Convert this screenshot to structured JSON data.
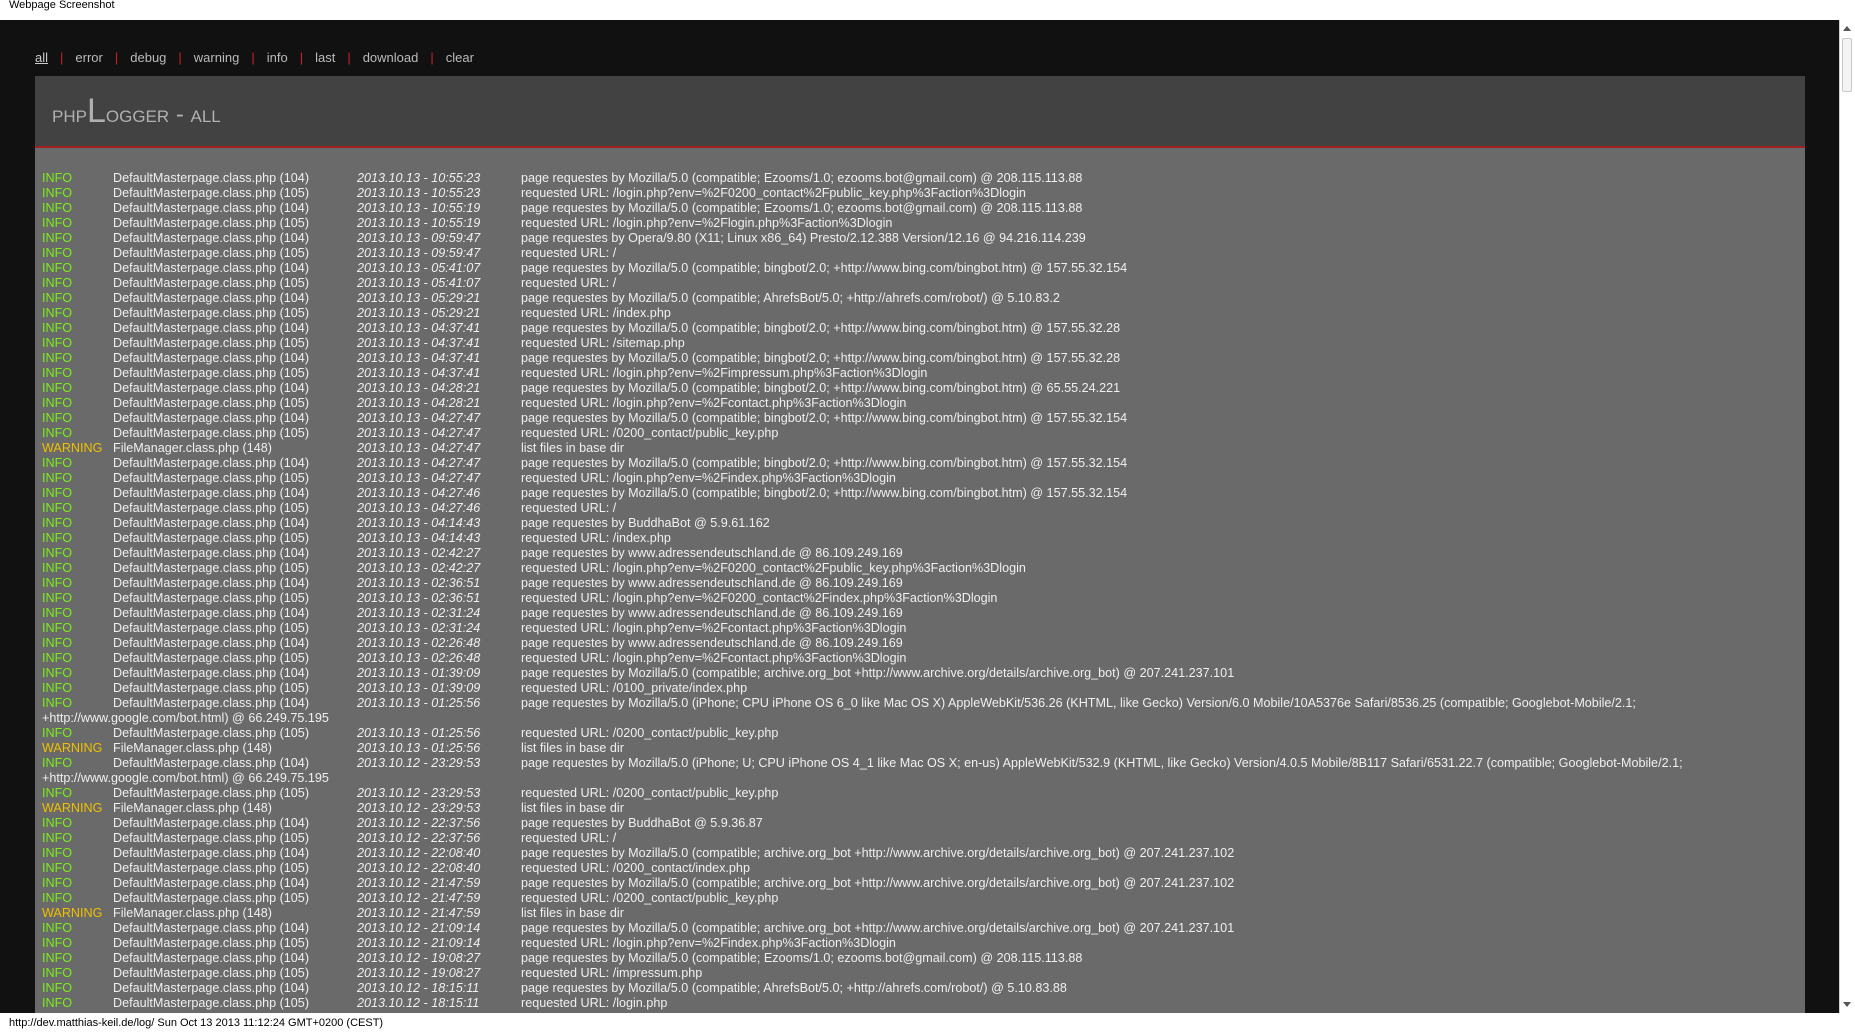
{
  "window_title": "Webpage Screenshot",
  "status_bar": "http://dev.matthias-keil.de/log/ Sun Oct 13 2013 11:12:24 GMT+0200 (CEST)",
  "nav": [
    {
      "label": "all",
      "active": true
    },
    {
      "label": "error"
    },
    {
      "label": "debug"
    },
    {
      "label": "warning"
    },
    {
      "label": "info"
    },
    {
      "label": "last"
    },
    {
      "label": "download"
    },
    {
      "label": "clear"
    }
  ],
  "title": {
    "prefix": "php",
    "big": "L",
    "rest": "ogger - all"
  },
  "colors": {
    "info": "#7aee1a",
    "warning": "#f0c000",
    "separator": "#cc2222",
    "panel": "#6a6a6a",
    "header": "#424242"
  },
  "log": [
    {
      "level": "INFO",
      "source": "DefaultMasterpage.class.php (104)",
      "time": "2013.10.13 - 10:55:23",
      "message": "page requestes by Mozilla/5.0 (compatible; Ezooms/1.0; ezooms.bot@gmail.com) @ 208.115.113.88"
    },
    {
      "level": "INFO",
      "source": "DefaultMasterpage.class.php (105)",
      "time": "2013.10.13 - 10:55:23",
      "message": "requested URL: /login.php?env=%2F0200_contact%2Fpublic_key.php%3Faction%3Dlogin"
    },
    {
      "level": "INFO",
      "source": "DefaultMasterpage.class.php (104)",
      "time": "2013.10.13 - 10:55:19",
      "message": "page requestes by Mozilla/5.0 (compatible; Ezooms/1.0; ezooms.bot@gmail.com) @ 208.115.113.88"
    },
    {
      "level": "INFO",
      "source": "DefaultMasterpage.class.php (105)",
      "time": "2013.10.13 - 10:55:19",
      "message": "requested URL: /login.php?env=%2Flogin.php%3Faction%3Dlogin"
    },
    {
      "level": "INFO",
      "source": "DefaultMasterpage.class.php (104)",
      "time": "2013.10.13 - 09:59:47",
      "message": "page requestes by Opera/9.80 (X11; Linux x86_64) Presto/2.12.388 Version/12.16 @ 94.216.114.239"
    },
    {
      "level": "INFO",
      "source": "DefaultMasterpage.class.php (105)",
      "time": "2013.10.13 - 09:59:47",
      "message": "requested URL: /"
    },
    {
      "level": "INFO",
      "source": "DefaultMasterpage.class.php (104)",
      "time": "2013.10.13 - 05:41:07",
      "message": "page requestes by Mozilla/5.0 (compatible; bingbot/2.0; +http://www.bing.com/bingbot.htm) @ 157.55.32.154"
    },
    {
      "level": "INFO",
      "source": "DefaultMasterpage.class.php (105)",
      "time": "2013.10.13 - 05:41:07",
      "message": "requested URL: /"
    },
    {
      "level": "INFO",
      "source": "DefaultMasterpage.class.php (104)",
      "time": "2013.10.13 - 05:29:21",
      "message": "page requestes by Mozilla/5.0 (compatible; AhrefsBot/5.0; +http://ahrefs.com/robot/) @ 5.10.83.2"
    },
    {
      "level": "INFO",
      "source": "DefaultMasterpage.class.php (105)",
      "time": "2013.10.13 - 05:29:21",
      "message": "requested URL: /index.php"
    },
    {
      "level": "INFO",
      "source": "DefaultMasterpage.class.php (104)",
      "time": "2013.10.13 - 04:37:41",
      "message": "page requestes by Mozilla/5.0 (compatible; bingbot/2.0; +http://www.bing.com/bingbot.htm) @ 157.55.32.28"
    },
    {
      "level": "INFO",
      "source": "DefaultMasterpage.class.php (105)",
      "time": "2013.10.13 - 04:37:41",
      "message": "requested URL: /sitemap.php"
    },
    {
      "level": "INFO",
      "source": "DefaultMasterpage.class.php (104)",
      "time": "2013.10.13 - 04:37:41",
      "message": "page requestes by Mozilla/5.0 (compatible; bingbot/2.0; +http://www.bing.com/bingbot.htm) @ 157.55.32.28"
    },
    {
      "level": "INFO",
      "source": "DefaultMasterpage.class.php (105)",
      "time": "2013.10.13 - 04:37:41",
      "message": "requested URL: /login.php?env=%2Fimpressum.php%3Faction%3Dlogin"
    },
    {
      "level": "INFO",
      "source": "DefaultMasterpage.class.php (104)",
      "time": "2013.10.13 - 04:28:21",
      "message": "page requestes by Mozilla/5.0 (compatible; bingbot/2.0; +http://www.bing.com/bingbot.htm) @ 65.55.24.221"
    },
    {
      "level": "INFO",
      "source": "DefaultMasterpage.class.php (105)",
      "time": "2013.10.13 - 04:28:21",
      "message": "requested URL: /login.php?env=%2Fcontact.php%3Faction%3Dlogin"
    },
    {
      "level": "INFO",
      "source": "DefaultMasterpage.class.php (104)",
      "time": "2013.10.13 - 04:27:47",
      "message": "page requestes by Mozilla/5.0 (compatible; bingbot/2.0; +http://www.bing.com/bingbot.htm) @ 157.55.32.154"
    },
    {
      "level": "INFO",
      "source": "DefaultMasterpage.class.php (105)",
      "time": "2013.10.13 - 04:27:47",
      "message": "requested URL: /0200_contact/public_key.php"
    },
    {
      "level": "WARNING",
      "source": "FileManager.class.php (148)",
      "time": "2013.10.13 - 04:27:47",
      "message": "list files in base dir"
    },
    {
      "level": "INFO",
      "source": "DefaultMasterpage.class.php (104)",
      "time": "2013.10.13 - 04:27:47",
      "message": "page requestes by Mozilla/5.0 (compatible; bingbot/2.0; +http://www.bing.com/bingbot.htm) @ 157.55.32.154"
    },
    {
      "level": "INFO",
      "source": "DefaultMasterpage.class.php (105)",
      "time": "2013.10.13 - 04:27:47",
      "message": "requested URL: /login.php?env=%2Findex.php%3Faction%3Dlogin"
    },
    {
      "level": "INFO",
      "source": "DefaultMasterpage.class.php (104)",
      "time": "2013.10.13 - 04:27:46",
      "message": "page requestes by Mozilla/5.0 (compatible; bingbot/2.0; +http://www.bing.com/bingbot.htm) @ 157.55.32.154"
    },
    {
      "level": "INFO",
      "source": "DefaultMasterpage.class.php (105)",
      "time": "2013.10.13 - 04:27:46",
      "message": "requested URL: /"
    },
    {
      "level": "INFO",
      "source": "DefaultMasterpage.class.php (104)",
      "time": "2013.10.13 - 04:14:43",
      "message": "page requestes by BuddhaBot @ 5.9.61.162"
    },
    {
      "level": "INFO",
      "source": "DefaultMasterpage.class.php (105)",
      "time": "2013.10.13 - 04:14:43",
      "message": "requested URL: /index.php"
    },
    {
      "level": "INFO",
      "source": "DefaultMasterpage.class.php (104)",
      "time": "2013.10.13 - 02:42:27",
      "message": "page requestes by www.adressendeutschland.de @ 86.109.249.169"
    },
    {
      "level": "INFO",
      "source": "DefaultMasterpage.class.php (105)",
      "time": "2013.10.13 - 02:42:27",
      "message": "requested URL: /login.php?env=%2F0200_contact%2Fpublic_key.php%3Faction%3Dlogin"
    },
    {
      "level": "INFO",
      "source": "DefaultMasterpage.class.php (104)",
      "time": "2013.10.13 - 02:36:51",
      "message": "page requestes by www.adressendeutschland.de @ 86.109.249.169"
    },
    {
      "level": "INFO",
      "source": "DefaultMasterpage.class.php (105)",
      "time": "2013.10.13 - 02:36:51",
      "message": "requested URL: /login.php?env=%2F0200_contact%2Findex.php%3Faction%3Dlogin"
    },
    {
      "level": "INFO",
      "source": "DefaultMasterpage.class.php (104)",
      "time": "2013.10.13 - 02:31:24",
      "message": "page requestes by www.adressendeutschland.de @ 86.109.249.169"
    },
    {
      "level": "INFO",
      "source": "DefaultMasterpage.class.php (105)",
      "time": "2013.10.13 - 02:31:24",
      "message": "requested URL: /login.php?env=%2Fcontact.php%3Faction%3Dlogin"
    },
    {
      "level": "INFO",
      "source": "DefaultMasterpage.class.php (104)",
      "time": "2013.10.13 - 02:26:48",
      "message": "page requestes by www.adressendeutschland.de @ 86.109.249.169"
    },
    {
      "level": "INFO",
      "source": "DefaultMasterpage.class.php (105)",
      "time": "2013.10.13 - 02:26:48",
      "message": "requested URL: /login.php?env=%2Fcontact.php%3Faction%3Dlogin"
    },
    {
      "level": "INFO",
      "source": "DefaultMasterpage.class.php (104)",
      "time": "2013.10.13 - 01:39:09",
      "message": "page requestes by Mozilla/5.0 (compatible; archive.org_bot +http://www.archive.org/details/archive.org_bot) @ 207.241.237.101"
    },
    {
      "level": "INFO",
      "source": "DefaultMasterpage.class.php (105)",
      "time": "2013.10.13 - 01:39:09",
      "message": "requested URL: /0100_private/index.php"
    },
    {
      "level": "INFO",
      "source": "DefaultMasterpage.class.php (104)",
      "time": "2013.10.13 - 01:25:56",
      "message": "page requestes by Mozilla/5.0 (iPhone; CPU iPhone OS 6_0 like Mac OS X) AppleWebKit/536.26 (KHTML, like Gecko) Version/6.0 Mobile/10A5376e Safari/8536.25 (compatible; Googlebot-Mobile/2.1;",
      "continuation": "+http://www.google.com/bot.html) @ 66.249.75.195"
    },
    {
      "level": "INFO",
      "source": "DefaultMasterpage.class.php (105)",
      "time": "2013.10.13 - 01:25:56",
      "message": "requested URL: /0200_contact/public_key.php"
    },
    {
      "level": "WARNING",
      "source": "FileManager.class.php (148)",
      "time": "2013.10.13 - 01:25:56",
      "message": "list files in base dir"
    },
    {
      "level": "INFO",
      "source": "DefaultMasterpage.class.php (104)",
      "time": "2013.10.12 - 23:29:53",
      "message": "page requestes by Mozilla/5.0 (iPhone; U; CPU iPhone OS 4_1 like Mac OS X; en-us) AppleWebKit/532.9 (KHTML, like Gecko) Version/4.0.5 Mobile/8B117 Safari/6531.22.7 (compatible; Googlebot-Mobile/2.1;",
      "continuation": "+http://www.google.com/bot.html) @ 66.249.75.195"
    },
    {
      "level": "INFO",
      "source": "DefaultMasterpage.class.php (105)",
      "time": "2013.10.12 - 23:29:53",
      "message": "requested URL: /0200_contact/public_key.php"
    },
    {
      "level": "WARNING",
      "source": "FileManager.class.php (148)",
      "time": "2013.10.12 - 23:29:53",
      "message": "list files in base dir"
    },
    {
      "level": "INFO",
      "source": "DefaultMasterpage.class.php (104)",
      "time": "2013.10.12 - 22:37:56",
      "message": "page requestes by BuddhaBot @ 5.9.36.87"
    },
    {
      "level": "INFO",
      "source": "DefaultMasterpage.class.php (105)",
      "time": "2013.10.12 - 22:37:56",
      "message": "requested URL: /"
    },
    {
      "level": "INFO",
      "source": "DefaultMasterpage.class.php (104)",
      "time": "2013.10.12 - 22:08:40",
      "message": "page requestes by Mozilla/5.0 (compatible; archive.org_bot +http://www.archive.org/details/archive.org_bot) @ 207.241.237.102"
    },
    {
      "level": "INFO",
      "source": "DefaultMasterpage.class.php (105)",
      "time": "2013.10.12 - 22:08:40",
      "message": "requested URL: /0200_contact/index.php"
    },
    {
      "level": "INFO",
      "source": "DefaultMasterpage.class.php (104)",
      "time": "2013.10.12 - 21:47:59",
      "message": "page requestes by Mozilla/5.0 (compatible; archive.org_bot +http://www.archive.org/details/archive.org_bot) @ 207.241.237.102"
    },
    {
      "level": "INFO",
      "source": "DefaultMasterpage.class.php (105)",
      "time": "2013.10.12 - 21:47:59",
      "message": "requested URL: /0200_contact/public_key.php"
    },
    {
      "level": "WARNING",
      "source": "FileManager.class.php (148)",
      "time": "2013.10.12 - 21:47:59",
      "message": "list files in base dir"
    },
    {
      "level": "INFO",
      "source": "DefaultMasterpage.class.php (104)",
      "time": "2013.10.12 - 21:09:14",
      "message": "page requestes by Mozilla/5.0 (compatible; archive.org_bot +http://www.archive.org/details/archive.org_bot) @ 207.241.237.101"
    },
    {
      "level": "INFO",
      "source": "DefaultMasterpage.class.php (105)",
      "time": "2013.10.12 - 21:09:14",
      "message": "requested URL: /login.php?env=%2Findex.php%3Faction%3Dlogin"
    },
    {
      "level": "INFO",
      "source": "DefaultMasterpage.class.php (104)",
      "time": "2013.10.12 - 19:08:27",
      "message": "page requestes by Mozilla/5.0 (compatible; Ezooms/1.0; ezooms.bot@gmail.com) @ 208.115.113.88"
    },
    {
      "level": "INFO",
      "source": "DefaultMasterpage.class.php (105)",
      "time": "2013.10.12 - 19:08:27",
      "message": "requested URL: /impressum.php"
    },
    {
      "level": "INFO",
      "source": "DefaultMasterpage.class.php (104)",
      "time": "2013.10.12 - 18:15:11",
      "message": "page requestes by Mozilla/5.0 (compatible; AhrefsBot/5.0; +http://ahrefs.com/robot/) @ 5.10.83.88"
    },
    {
      "level": "INFO",
      "source": "DefaultMasterpage.class.php (105)",
      "time": "2013.10.12 - 18:15:11",
      "message": "requested URL: /login.php"
    }
  ]
}
